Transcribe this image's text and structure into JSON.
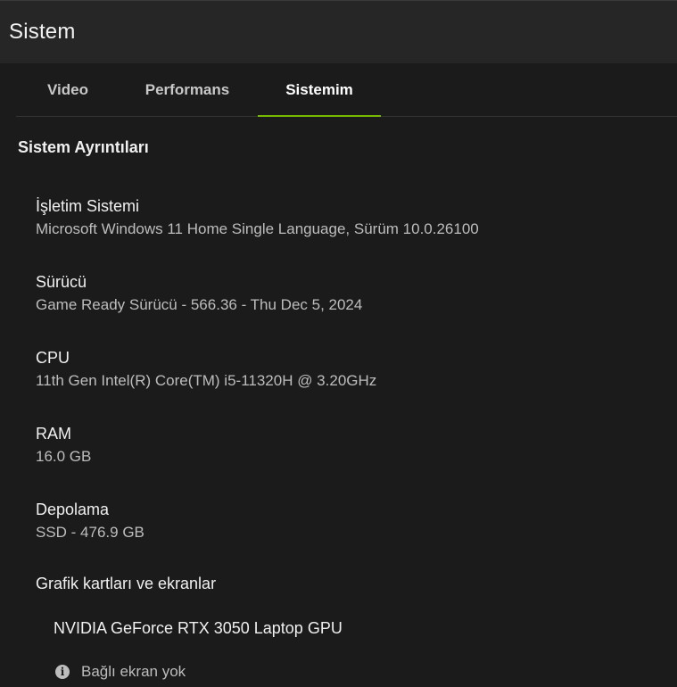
{
  "header": {
    "title": "Sistem"
  },
  "tabs": [
    {
      "label": "Video"
    },
    {
      "label": "Performans"
    },
    {
      "label": "Sistemim",
      "active": true
    }
  ],
  "colors": {
    "accent": "#76b900",
    "background": "#1b1b1b",
    "header": "#262626"
  },
  "section": {
    "title": "Sistem Ayrıntıları"
  },
  "details": [
    {
      "label": "İşletim Sistemi",
      "value": "Microsoft Windows 11 Home Single Language, Sürüm 10.0.26100"
    },
    {
      "label": "Sürücü",
      "value": "Game Ready Sürücü - 566.36 - Thu Dec 5, 2024"
    },
    {
      "label": "CPU",
      "value": "11th Gen Intel(R) Core(TM) i5-11320H @ 3.20GHz"
    },
    {
      "label": "RAM",
      "value": "16.0 GB"
    },
    {
      "label": "Depolama",
      "value": "SSD - 476.9 GB"
    }
  ],
  "graphics": {
    "heading": "Grafik kartları ve ekranlar",
    "gpu_name": "NVIDIA GeForce RTX 3050 Laptop GPU",
    "notice_icon": "info-icon",
    "notice_glyph": "i",
    "notice": "Bağlı ekran yok"
  }
}
